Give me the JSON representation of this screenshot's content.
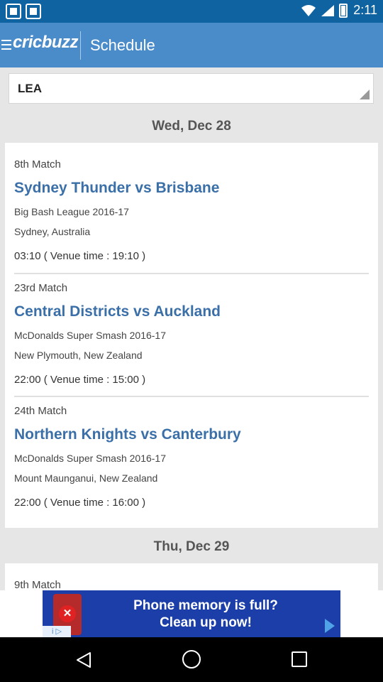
{
  "status_bar": {
    "time": "2:11"
  },
  "app_bar": {
    "logo": "cricbuzz",
    "title": "Schedule"
  },
  "filter": {
    "value": "LEA"
  },
  "days": [
    {
      "date": "Wed, Dec 28",
      "matches": [
        {
          "number": "8th Match",
          "title": "Sydney Thunder vs Brisbane",
          "series": "Big Bash League 2016-17",
          "venue": "Sydney, Australia",
          "time": "03:10 ( Venue time : 19:10 )"
        },
        {
          "number": "23rd Match",
          "title": "Central Districts vs Auckland",
          "series": "McDonalds Super Smash 2016-17",
          "venue": "New Plymouth, New Zealand",
          "time": "22:00 ( Venue time : 15:00 )"
        },
        {
          "number": "24th Match",
          "title": "Northern Knights vs Canterbury",
          "series": "McDonalds Super Smash 2016-17",
          "venue": "Mount Maunganui, New Zealand",
          "time": "22:00 ( Venue time : 16:00 )"
        }
      ]
    },
    {
      "date": "Thu, Dec 29",
      "matches": [
        {
          "number": "9th Match"
        }
      ]
    }
  ],
  "ad": {
    "line1": "Phone memory is full?",
    "line2": "Clean up now!"
  }
}
